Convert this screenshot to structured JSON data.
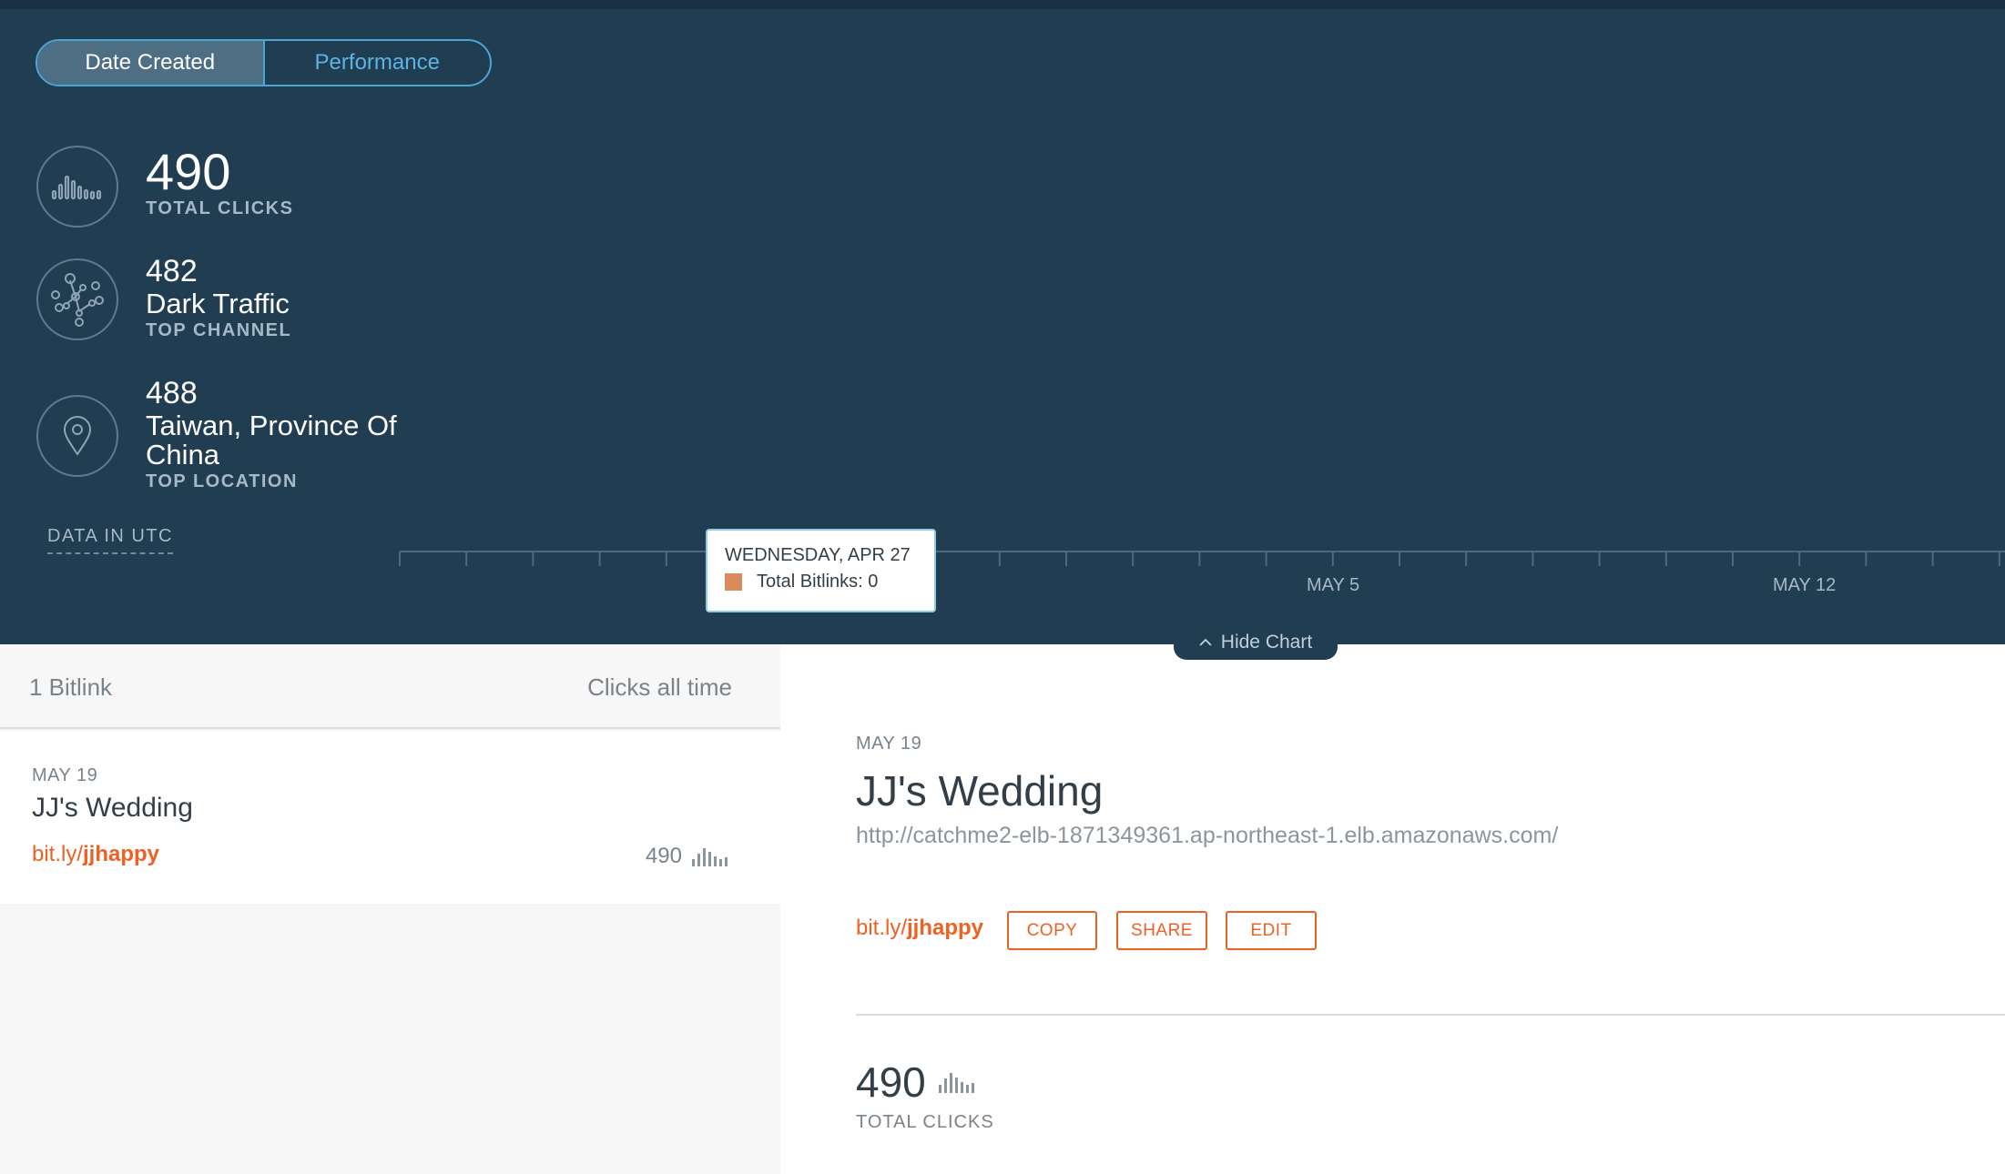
{
  "tabs": {
    "date_created": "Date Created",
    "performance": "Performance"
  },
  "stats": {
    "total_clicks": {
      "value": "490",
      "label": "TOTAL CLICKS"
    },
    "top_channel": {
      "value": "482",
      "name": "Dark Traffic",
      "label": "TOP CHANNEL"
    },
    "top_location": {
      "value": "488",
      "name_line1": "Taiwan, Province Of",
      "name_line2": "China",
      "label": "TOP LOCATION"
    }
  },
  "data_in_utc": "DATA IN UTC",
  "chart": {
    "tick_labels": [
      "MAY 5",
      "MAY 12"
    ],
    "tooltip": {
      "date": "WEDNESDAY, APR 27",
      "series": "Total Bitlinks",
      "value": 0,
      "text": "Total Bitlinks: 0",
      "swatch_color": "#d98b5b"
    }
  },
  "hide_chart": "Hide Chart",
  "list": {
    "count": "1 Bitlink",
    "sort": "Clicks all time",
    "items": [
      {
        "date": "MAY 19",
        "title": "JJ's Wedding",
        "link_prefix": "bit.ly/",
        "link_suffix": "jjhappy",
        "clicks": "490"
      }
    ]
  },
  "detail": {
    "date": "MAY 19",
    "title": "JJ's Wedding",
    "long_url": "http://catchme2-elb-1871349361.ap-northeast-1.elb.amazonaws.com/",
    "short_prefix": "bit.ly/",
    "short_suffix": "jjhappy",
    "buttons": {
      "copy": "COPY",
      "share": "SHARE",
      "edit": "EDIT"
    },
    "total_clicks": "490",
    "total_label": "TOTAL CLICKS"
  },
  "colors": {
    "panel": "#213d51",
    "accent": "#ee6123",
    "toggle_border": "#4aa6d6"
  }
}
